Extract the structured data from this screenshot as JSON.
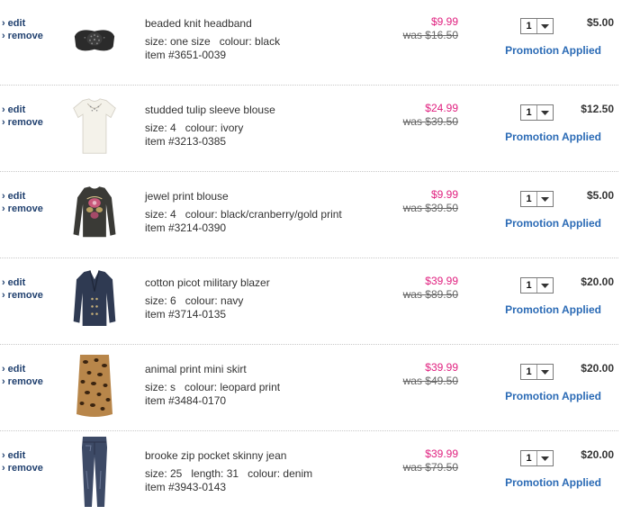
{
  "items": [
    {
      "actions": {
        "edit": "edit",
        "remove": "remove"
      },
      "image": "headband-icon",
      "name": "beaded knit headband",
      "attrs": [
        "size: one size",
        "colour: black"
      ],
      "item_number": "item #3651-0039",
      "price": "$9.99",
      "was": "was $16.50",
      "qty": "1",
      "total": "$5.00",
      "promotion": "Promotion Applied"
    },
    {
      "actions": {
        "edit": "edit",
        "remove": "remove"
      },
      "image": "blouse-icon",
      "name": "studded tulip sleeve blouse",
      "attrs": [
        "size: 4",
        "colour: ivory"
      ],
      "item_number": "item #3213-0385",
      "price": "$24.99",
      "was": "was $39.50",
      "qty": "1",
      "total": "$12.50",
      "promotion": "Promotion Applied"
    },
    {
      "actions": {
        "edit": "edit",
        "remove": "remove"
      },
      "image": "print-blouse-icon",
      "name": "jewel print blouse",
      "attrs": [
        "size: 4",
        "colour: black/cranberry/gold print"
      ],
      "item_number": "item #3214-0390",
      "price": "$9.99",
      "was": "was $39.50",
      "qty": "1",
      "total": "$5.00",
      "promotion": "Promotion Applied"
    },
    {
      "actions": {
        "edit": "edit",
        "remove": "remove"
      },
      "image": "blazer-icon",
      "name": "cotton picot military blazer",
      "attrs": [
        "size: 6",
        "colour: navy"
      ],
      "item_number": "item #3714-0135",
      "price": "$39.99",
      "was": "was $89.50",
      "qty": "1",
      "total": "$20.00",
      "promotion": "Promotion Applied"
    },
    {
      "actions": {
        "edit": "edit",
        "remove": "remove"
      },
      "image": "skirt-icon",
      "name": "animal print mini skirt",
      "attrs": [
        "size: s",
        "colour: leopard print"
      ],
      "item_number": "item #3484-0170",
      "price": "$39.99",
      "was": "was $49.50",
      "qty": "1",
      "total": "$20.00",
      "promotion": "Promotion Applied"
    },
    {
      "actions": {
        "edit": "edit",
        "remove": "remove"
      },
      "image": "jeans-icon",
      "name": "brooke zip pocket skinny jean",
      "attrs": [
        "size: 25",
        "length: 31",
        "colour: denim"
      ],
      "item_number": "item #3943-0143",
      "price": "$39.99",
      "was": "was $79.50",
      "qty": "1",
      "total": "$20.00",
      "promotion": "Promotion Applied"
    }
  ],
  "colors": {
    "sale_price": "#e0207f",
    "promo_link": "#2a6ab5",
    "action_link": "#1f3f6e"
  }
}
